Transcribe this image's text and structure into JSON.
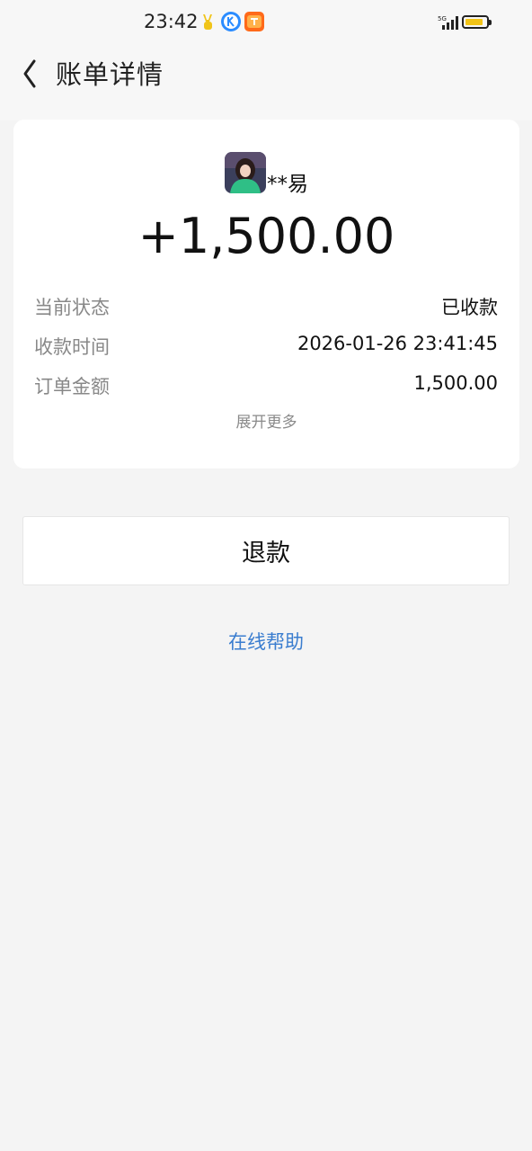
{
  "status_bar": {
    "time": "23:42"
  },
  "header": {
    "title": "账单详情"
  },
  "payment": {
    "payer_name": "**易",
    "amount": "+1,500.00",
    "details": [
      {
        "label": "当前状态",
        "value": "已收款"
      },
      {
        "label": "收款时间",
        "value": "2026-01-26 23:41:45"
      },
      {
        "label": "订单金额",
        "value": "1,500.00"
      }
    ],
    "expand_label": "展开更多"
  },
  "actions": {
    "refund_label": "退款",
    "help_label": "在线帮助"
  },
  "colors": {
    "link": "#3a7dcf",
    "background": "#f4f4f4",
    "battery": "#f2c417"
  }
}
